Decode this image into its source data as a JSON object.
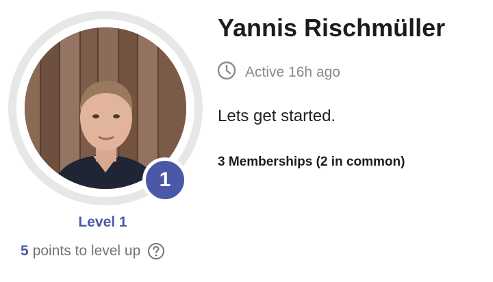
{
  "profile": {
    "name": "Yannis Rischmüller",
    "status": "Active 16h ago",
    "status_icon": "clock-icon",
    "bio": "Lets get started.",
    "memberships": "3 Memberships (2 in common)",
    "level_badge": "1",
    "level_label": "Level 1",
    "points_value": "5",
    "points_text": "points to level up",
    "help_icon": "question-circle-icon"
  },
  "colors": {
    "accent": "#4a58a8",
    "ring": "#e7e7e7",
    "muted_text": "#8a8a8a"
  }
}
